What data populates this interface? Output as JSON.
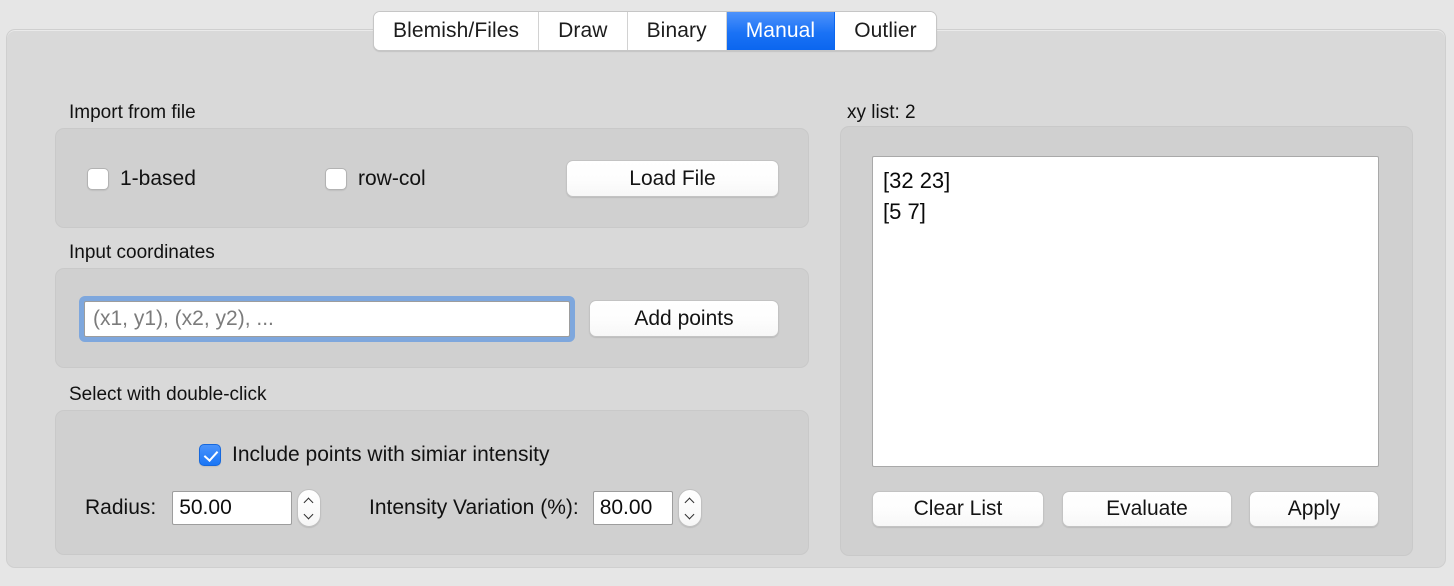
{
  "tabs": [
    {
      "label": "Blemish/Files",
      "selected": false
    },
    {
      "label": "Draw",
      "selected": false
    },
    {
      "label": "Binary",
      "selected": false
    },
    {
      "label": "Manual",
      "selected": true
    },
    {
      "label": "Outlier",
      "selected": false
    }
  ],
  "colors": {
    "accent": "#1a72f5",
    "window_bg": "#e6e6e6",
    "container_bg": "#d9d9d9",
    "groupbox_bg": "#d0d0d0",
    "focus_ring": "#7ea7dd"
  },
  "import_section": {
    "label": "Import from file",
    "one_based": {
      "label": "1-based",
      "checked": false
    },
    "row_col": {
      "label": "row-col",
      "checked": false
    },
    "load_file_button": "Load File"
  },
  "input_section": {
    "label": "Input coordinates",
    "coord_input": {
      "value": "",
      "placeholder": "(x1, y1), (x2, y2), ..."
    },
    "add_points_button": "Add points"
  },
  "select_section": {
    "label": "Select with double-click",
    "include_similar": {
      "label": "Include points with simiar intensity",
      "checked": true
    },
    "radius": {
      "label": "Radius:",
      "value": "50.00"
    },
    "intensity_variation": {
      "label": "Intensity Variation (%):",
      "value": "80.00"
    }
  },
  "xy_panel": {
    "label": "xy list: 2",
    "entries": [
      "[32 23]",
      "[5 7]"
    ],
    "clear_button": "Clear List",
    "evaluate_button": "Evaluate",
    "apply_button": "Apply"
  }
}
